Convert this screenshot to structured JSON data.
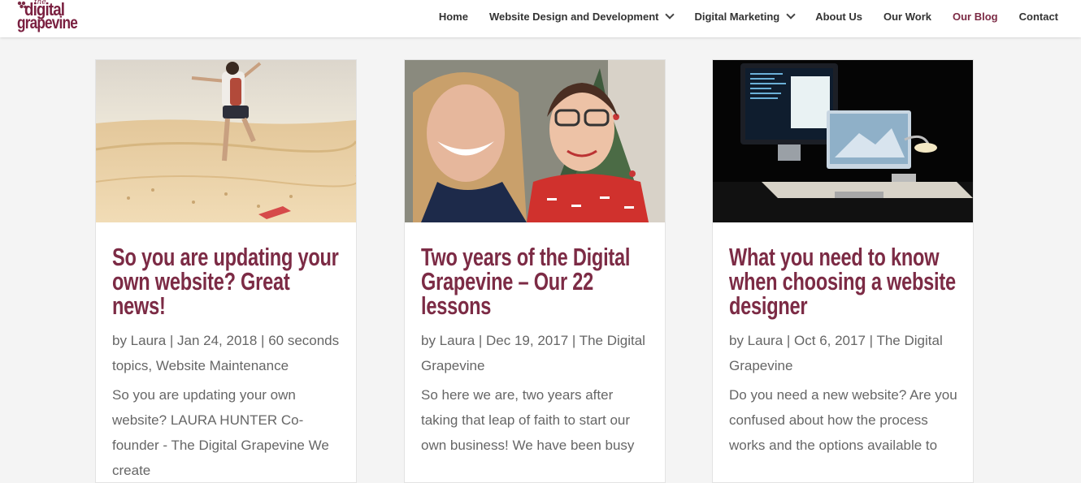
{
  "brand": {
    "logo_small": "the",
    "logo_line1": "digital",
    "logo_line2": "grapevine",
    "color": "#7c2b45"
  },
  "nav": {
    "home": "Home",
    "web_design": "Website Design and Development",
    "marketing": "Digital Marketing",
    "about": "About Us",
    "work": "Our Work",
    "blog": "Our Blog",
    "contact": "Contact"
  },
  "posts": [
    {
      "image": "desert-jump-photo",
      "title": "So you are updating your own website? Great news!",
      "meta": "by Laura | Jan 24, 2018 | 60 seconds topics, Website Maintenance",
      "excerpt": "So you are updating your own website? LAURA HUNTER Co-founder - The Digital Grapevine We create"
    },
    {
      "image": "founders-selfie-photo",
      "title": "Two years of the Digital Grapevine – Our 22 lessons",
      "meta": "by Laura | Dec 19, 2017 | The Digital Grapevine",
      "excerpt": "So here we are, two years after taking that leap of faith to start our own business!  We have been busy"
    },
    {
      "image": "desk-computer-photo",
      "title": "What you need to know when choosing a website designer",
      "meta": "by Laura | Oct 6, 2017 | The Digital Grapevine",
      "excerpt": "Do you need a new website? Are you confused about how the process works and the options available to"
    }
  ]
}
